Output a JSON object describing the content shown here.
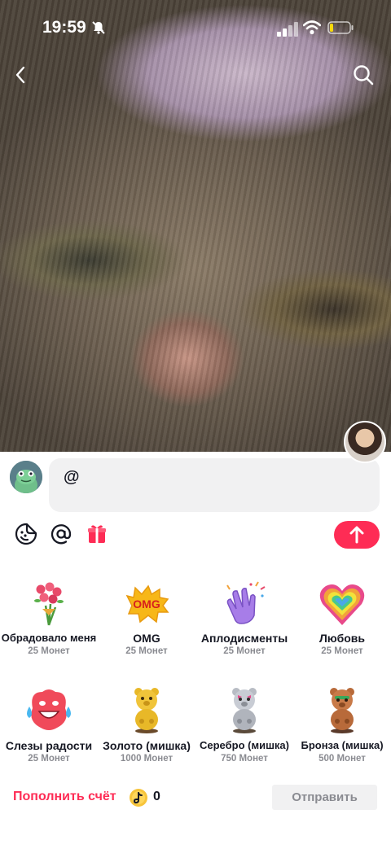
{
  "status_bar": {
    "time": "19:59"
  },
  "comment": {
    "text": "@"
  },
  "send_color": "#fe2c55",
  "gifts": [
    {
      "name": "Обрадовало меня",
      "price": "25 Монет",
      "icon": "roses-bouquet-icon"
    },
    {
      "name": "OMG",
      "price": "25 Монет",
      "icon": "omg-sticker-icon"
    },
    {
      "name": "Аплодисменты",
      "price": "25 Монет",
      "icon": "clapping-hands-icon"
    },
    {
      "name": "Любовь",
      "price": "25 Монет",
      "icon": "rainbow-heart-icon"
    },
    {
      "name": "Слезы радости",
      "price": "25 Монет",
      "icon": "tears-of-joy-icon"
    },
    {
      "name": "Золото (мишка)",
      "price": "1000 Монет",
      "icon": "gold-bear-icon"
    },
    {
      "name": "Серебро (мишка)",
      "price": "750 Монет",
      "icon": "silver-bear-icon"
    },
    {
      "name": "Бронза (мишка)",
      "price": "500 Монет",
      "icon": "bronze-bear-icon"
    }
  ],
  "footer": {
    "topup_label": "Пополнить счёт",
    "balance": "0",
    "submit_label": "Отправить"
  }
}
